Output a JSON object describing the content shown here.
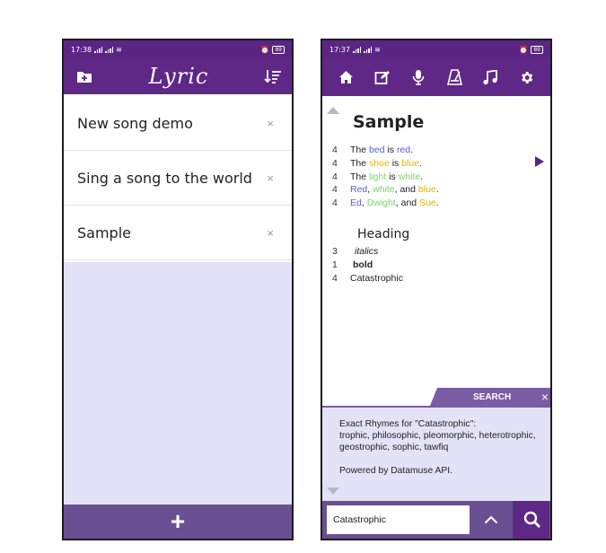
{
  "left": {
    "status": {
      "time": "17:38",
      "battery": "89"
    },
    "app_title": "Lyric",
    "icons": {
      "add_folder": "folder-plus-icon",
      "sort": "sort-icon",
      "delete": "close-icon",
      "add": "plus-icon"
    },
    "songs": [
      {
        "title": "New song demo",
        "delete": "×"
      },
      {
        "title": "Sing a song to the world",
        "delete": "×"
      },
      {
        "title": "Sample",
        "delete": "×"
      }
    ],
    "add_label": "+"
  },
  "right": {
    "status": {
      "time": "17:37",
      "battery": "89"
    },
    "toolbar_icons": [
      "home-icon",
      "edit-icon",
      "microphone-icon",
      "metronome-icon",
      "music-note-icon",
      "settings-icon"
    ],
    "sheet_title": "Sample",
    "lines": [
      {
        "count": "4",
        "parts": [
          {
            "t": "The ",
            "c": "#222"
          },
          {
            "t": "bed",
            "c": "#5b5ed4"
          },
          {
            "t": " is ",
            "c": "#222"
          },
          {
            "t": "red",
            "c": "#5b5ed4"
          },
          {
            "t": ".",
            "c": "#222"
          }
        ]
      },
      {
        "count": "4",
        "parts": [
          {
            "t": "The ",
            "c": "#222"
          },
          {
            "t": "shoe",
            "c": "#e8b400"
          },
          {
            "t": " is ",
            "c": "#222"
          },
          {
            "t": "blue",
            "c": "#e8b400"
          },
          {
            "t": ".",
            "c": "#222"
          }
        ]
      },
      {
        "count": "4",
        "parts": [
          {
            "t": "The ",
            "c": "#222"
          },
          {
            "t": "light",
            "c": "#7fd36a"
          },
          {
            "t": " is ",
            "c": "#222"
          },
          {
            "t": "white",
            "c": "#7fd36a"
          },
          {
            "t": ".",
            "c": "#222"
          }
        ]
      },
      {
        "count": "4",
        "parts": [
          {
            "t": "Red",
            "c": "#5b5ed4"
          },
          {
            "t": ", ",
            "c": "#222"
          },
          {
            "t": "white",
            "c": "#7fd36a"
          },
          {
            "t": ", and ",
            "c": "#222"
          },
          {
            "t": "blue",
            "c": "#e8b400"
          },
          {
            "t": ".",
            "c": "#222"
          }
        ]
      },
      {
        "count": "4",
        "parts": [
          {
            "t": "Ed",
            "c": "#5b5ed4"
          },
          {
            "t": ", ",
            "c": "#222"
          },
          {
            "t": "Dwight",
            "c": "#7fd36a"
          },
          {
            "t": ", and ",
            "c": "#222"
          },
          {
            "t": "Sue",
            "c": "#e8b400"
          },
          {
            "t": ".",
            "c": "#222"
          }
        ]
      }
    ],
    "heading": "Heading",
    "lines2": [
      {
        "count": "3",
        "text": "italics",
        "style": "italic"
      },
      {
        "count": "1",
        "text": "bold",
        "style": "bold"
      },
      {
        "count": "4",
        "text": "Catastrophic",
        "style": "normal"
      }
    ],
    "search_tab": {
      "label": "SEARCH",
      "close": "×"
    },
    "rhymes": {
      "header": "Exact Rhymes for \"Catastrophic\":",
      "words": "trophic, philosophic, pleomorphic, heterotrophic, geostrophic, sophic, tawfiq",
      "powered": "Powered by Datamuse API."
    },
    "search_value": "Catastrophic"
  },
  "colors": {
    "purple": "#5f2786",
    "lavender": "#e4e2f7",
    "bar": "#6a4f93",
    "blue_rhyme": "#5b5ed4",
    "yellow_rhyme": "#e8b400",
    "green_rhyme": "#7fd36a"
  }
}
